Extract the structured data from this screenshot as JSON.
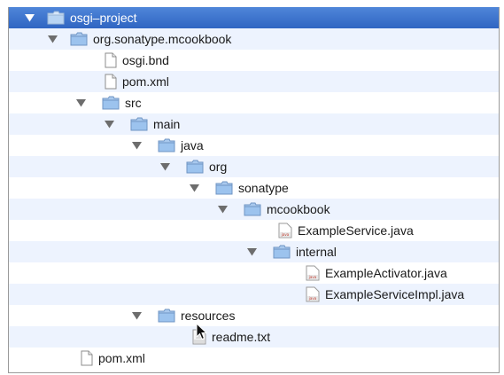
{
  "tree": {
    "items": [
      {
        "label": "osgi–project",
        "type": "folder",
        "expanded": true,
        "selected": true
      },
      {
        "label": "org.sonatype.mcookbook",
        "type": "folder",
        "expanded": true
      },
      {
        "label": "osgi.bnd",
        "type": "file"
      },
      {
        "label": "pom.xml",
        "type": "file"
      },
      {
        "label": "src",
        "type": "folder",
        "expanded": true
      },
      {
        "label": "main",
        "type": "folder",
        "expanded": true
      },
      {
        "label": "java",
        "type": "folder",
        "expanded": true
      },
      {
        "label": "org",
        "type": "folder",
        "expanded": true
      },
      {
        "label": "sonatype",
        "type": "folder",
        "expanded": true
      },
      {
        "label": "mcookbook",
        "type": "folder",
        "expanded": true
      },
      {
        "label": "ExampleService.java",
        "type": "java"
      },
      {
        "label": "internal",
        "type": "folder",
        "expanded": true
      },
      {
        "label": "ExampleActivator.java",
        "type": "java"
      },
      {
        "label": "ExampleServiceImpl.java",
        "type": "java"
      },
      {
        "label": "resources",
        "type": "folder",
        "expanded": true
      },
      {
        "label": "readme.txt",
        "type": "txt"
      },
      {
        "label": "pom.xml",
        "type": "file"
      }
    ]
  },
  "colors": {
    "selection": "#3a74cf",
    "alternate_row": "#edf3fe",
    "folder_fill": "#9cc3ee",
    "folder_tab": "#7fb0e6"
  }
}
